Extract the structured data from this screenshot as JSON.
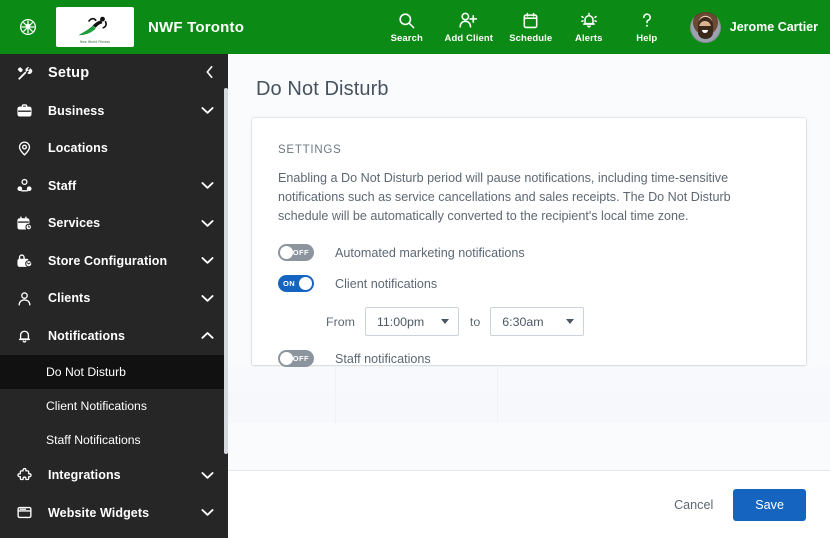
{
  "topbar": {
    "brand_mark_icon": "flower-badge-icon",
    "logo_caption": "New World Fitness",
    "brand_name": "NWF Toronto",
    "nav": [
      {
        "label": "Search",
        "icon": "search-icon",
        "name": "topnav-search"
      },
      {
        "label": "Add Client",
        "icon": "add-person-icon",
        "name": "topnav-add-client"
      },
      {
        "label": "Schedule",
        "icon": "calendar-icon",
        "name": "topnav-schedule"
      },
      {
        "label": "Alerts",
        "icon": "bell-icon",
        "name": "topnav-alerts"
      },
      {
        "label": "Help",
        "icon": "question-mark-icon",
        "name": "topnav-help"
      }
    ],
    "user": {
      "name": "Jerome Cartier",
      "avatar_icon": "user-avatar"
    }
  },
  "sidebar": {
    "header": {
      "label": "Setup",
      "icon": "tools-icon",
      "collapse_icon": "chevron-left-icon"
    },
    "items": [
      {
        "label": "Business",
        "icon": "briefcase-icon",
        "chevron": "chevron-down-icon"
      },
      {
        "label": "Locations",
        "icon": "map-pin-icon",
        "chevron": ""
      },
      {
        "label": "Staff",
        "icon": "staff-icon",
        "chevron": "chevron-down-icon"
      },
      {
        "label": "Services",
        "icon": "services-calendar-icon",
        "chevron": "chevron-down-icon"
      },
      {
        "label": "Store Configuration",
        "icon": "store-lock-icon",
        "chevron": "chevron-down-icon"
      },
      {
        "label": "Clients",
        "icon": "person-icon",
        "chevron": "chevron-down-icon"
      },
      {
        "label": "Notifications",
        "icon": "bell-icon",
        "chevron": "chevron-up-icon"
      }
    ],
    "sub_items": [
      {
        "label": "Do Not Disturb",
        "active": true
      },
      {
        "label": "Client Notifications",
        "active": false
      },
      {
        "label": "Staff Notifications",
        "active": false
      }
    ],
    "items_after": [
      {
        "label": "Integrations",
        "icon": "puzzle-icon",
        "chevron": "chevron-down-icon"
      },
      {
        "label": "Website Widgets",
        "icon": "window-icon",
        "chevron": "chevron-down-icon"
      }
    ]
  },
  "main": {
    "page_title": "Do Not Disturb",
    "card": {
      "section_label": "SETTINGS",
      "description": "Enabling a Do Not Disturb period will pause notifications, including time-sensitive notifications such as service cancellations and sales receipts. The Do Not Disturb schedule will be automatically converted to the recipient's local time zone.",
      "toggles": [
        {
          "state_text": "OFF",
          "state": "off",
          "label": "Automated marketing notifications",
          "name": "automated-marketing-notifications-toggle"
        },
        {
          "state_text": "ON",
          "state": "on",
          "label": "Client notifications",
          "name": "client-notifications-toggle"
        },
        {
          "state_text": "OFF",
          "state": "off",
          "label": "Staff notifications",
          "name": "staff-notifications-toggle"
        }
      ],
      "time_range": {
        "from_label": "From",
        "from_value": "11:00pm",
        "to_label": "to",
        "to_value": "6:30am"
      }
    }
  },
  "footer": {
    "cancel_label": "Cancel",
    "save_label": "Save"
  },
  "colors": {
    "header_green": "#0b8a15",
    "sidebar_dark": "#262626",
    "sidebar_active": "#111111",
    "accent_blue": "#1565c0",
    "toggle_off_gray": "#8c959d",
    "page_bg": "#fafbfc",
    "title_text": "#46525f",
    "body_text": "#5d6873"
  }
}
